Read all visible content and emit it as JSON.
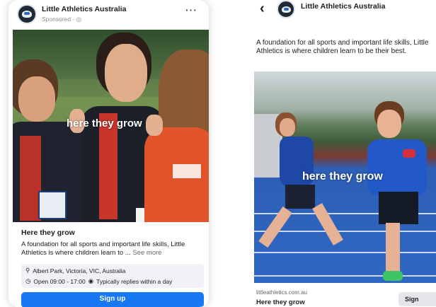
{
  "left_ad": {
    "page_name": "Little Athletics Australia",
    "sponsored": "Sponsored · ◎",
    "more_icon": "···",
    "photo_caption": "here they grow",
    "headline": "Here they grow",
    "body_text": "A foundation for all sports and important life skills, Little Athletics is where children learn to ...",
    "see_more": "See more",
    "location": "Albert Park, Victoria, VIC, Australia",
    "hours": "Open 09:00 - 17:00",
    "reply_time": "Typically replies within a day",
    "cta_label": "Sign up"
  },
  "right_ad": {
    "back_icon": "‹",
    "page_name": "Little Athletics Australia",
    "body_text": "A foundation for all sports and important life skills, Little Athletics is where children learn to be their best.",
    "photo_caption": "here they grow",
    "link_domain": "littleathletics.com.au",
    "headline": "Here they grow",
    "cta_label": "Sign"
  },
  "icons": {
    "location_icon": "⚲",
    "clock_icon": "◷",
    "chat_icon": "◉"
  },
  "colors": {
    "cta_blue": "#1877f2",
    "meta_bg": "#f0f2f5",
    "secondary_text": "#65676b"
  }
}
